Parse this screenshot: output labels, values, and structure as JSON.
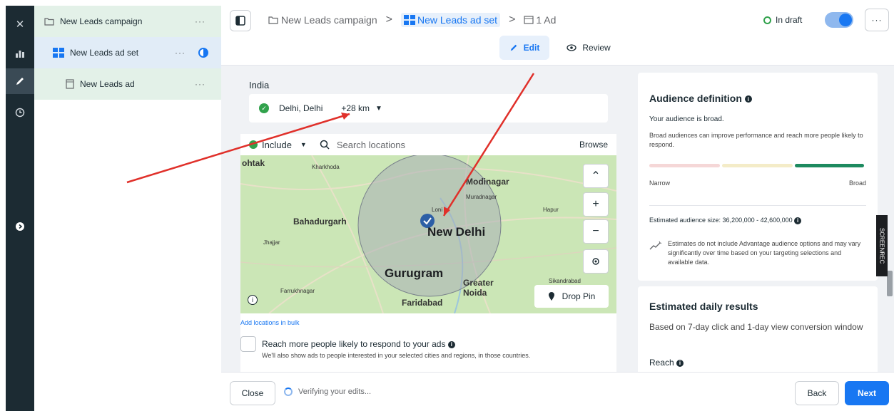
{
  "sidebar_rail": {
    "icons": [
      "close-icon",
      "chart-icon",
      "pencil-icon",
      "clock-icon",
      "help-icon"
    ]
  },
  "tree": {
    "campaign": "New Leads campaign",
    "ad_set": "New Leads ad set",
    "ad": "New Leads ad",
    "more": "···"
  },
  "breadcrumb": {
    "campaign": "New Leads campaign",
    "ad_set": "New Leads ad set",
    "ad": "1 Ad",
    "separator": ">"
  },
  "header": {
    "status": "In draft",
    "more": "···",
    "toggle_on": true
  },
  "tabs": {
    "edit": "Edit",
    "review": "Review"
  },
  "location": {
    "country": "India",
    "city": "Delhi, Delhi",
    "radius": "+28 km",
    "include": "Include",
    "search_placeholder": "Search locations",
    "browse": "Browse",
    "drop_pin": "Drop Pin",
    "add_bulk": "Add locations in bulk",
    "reach_label": "Reach more people likely to respond to your ads",
    "reach_sub": "We'll also show ads to people interested in your selected cities and regions, in those countries."
  },
  "map": {
    "labels": [
      {
        "name": "Rohtak",
        "text": "ohtak"
      },
      {
        "name": "Kharkhoda",
        "text": "Kharkhoda"
      },
      {
        "name": "Modinagar",
        "text": "Modinagar"
      },
      {
        "name": "Muradnagar",
        "text": "Muradnagar"
      },
      {
        "name": "Loni",
        "text": "Loni"
      },
      {
        "name": "Hapur",
        "text": "Hapur"
      },
      {
        "name": "Bahadurgarh",
        "text": "Bahadurgarh"
      },
      {
        "name": "New Delhi",
        "text": "New Delhi"
      },
      {
        "name": "Jhajjar",
        "text": "Jhajjar"
      },
      {
        "name": "Gurugram",
        "text": "Gurugram"
      },
      {
        "name": "Greater Noida",
        "text": "Greater Noida"
      },
      {
        "name": "Pataudi",
        "text": "Farrukhnagar"
      },
      {
        "name": "Faridabad",
        "text": "Faridabad"
      },
      {
        "name": "Sikandrabad",
        "text": "Sikandrabad"
      }
    ],
    "zoom_controls": [
      "collapse",
      "zoom-in",
      "zoom-out",
      "locate"
    ]
  },
  "audience": {
    "title": "Audience definition",
    "summary": "Your audience is broad.",
    "description": "Broad audiences can improve performance and reach more people likely to respond.",
    "narrow": "Narrow",
    "broad": "Broad",
    "size": "Estimated audience size: 36,200,000 - 42,600,000",
    "note": "Estimates do not include Advantage audience options and may vary significantly over time based on your targeting selections and available data.",
    "meter_colors": [
      "#f5d7d7",
      "#f4ecc8",
      "#1d8a5f"
    ]
  },
  "estimated": {
    "title": "Estimated daily results",
    "description": "Based on 7-day click and 1-day view conversion window",
    "reach": "Reach"
  },
  "footer": {
    "close": "Close",
    "verifying": "Verifying your edits...",
    "back": "Back",
    "next": "Next"
  },
  "screen_rec": "SCREENREC",
  "colors": {
    "accent": "#1877f2",
    "draft": "#31a24c",
    "annotation": "#e0302a"
  }
}
